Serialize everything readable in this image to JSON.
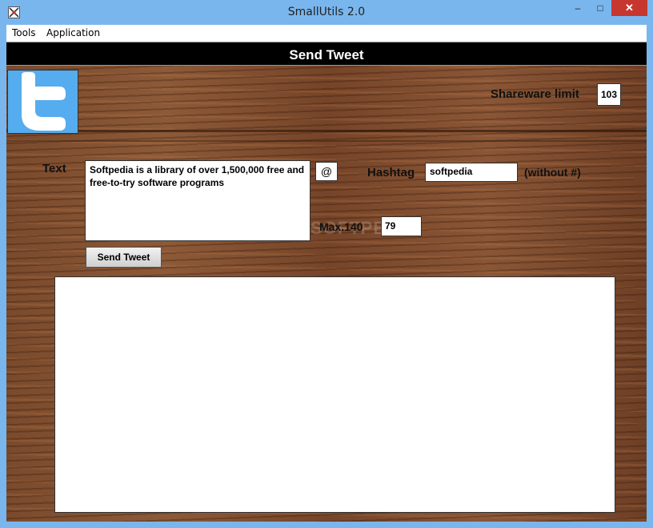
{
  "window": {
    "title": "SmallUtils 2.0",
    "minimize_glyph": "–",
    "maximize_glyph": "□",
    "close_glyph": "✕"
  },
  "menu": {
    "items": [
      "Tools",
      "Application"
    ]
  },
  "header": {
    "title": "Send Tweet"
  },
  "shareware": {
    "label": "Shareware limit",
    "value": "103"
  },
  "form": {
    "text_label": "Text",
    "text_value": "Softpedia is a library of over 1,500,000 free and free-to-try software programs",
    "at_button": "@",
    "hashtag_label": "Hashtag",
    "hashtag_value": "softpedia",
    "hashtag_hint": "(without #)",
    "max_label": "Max.140",
    "char_count": "79",
    "send_button": "Send Tweet"
  },
  "watermark": "SOFTPEDIA",
  "colors": {
    "twitter_blue": "#55acee",
    "close_red": "#c7372f",
    "header_black": "#000000"
  }
}
